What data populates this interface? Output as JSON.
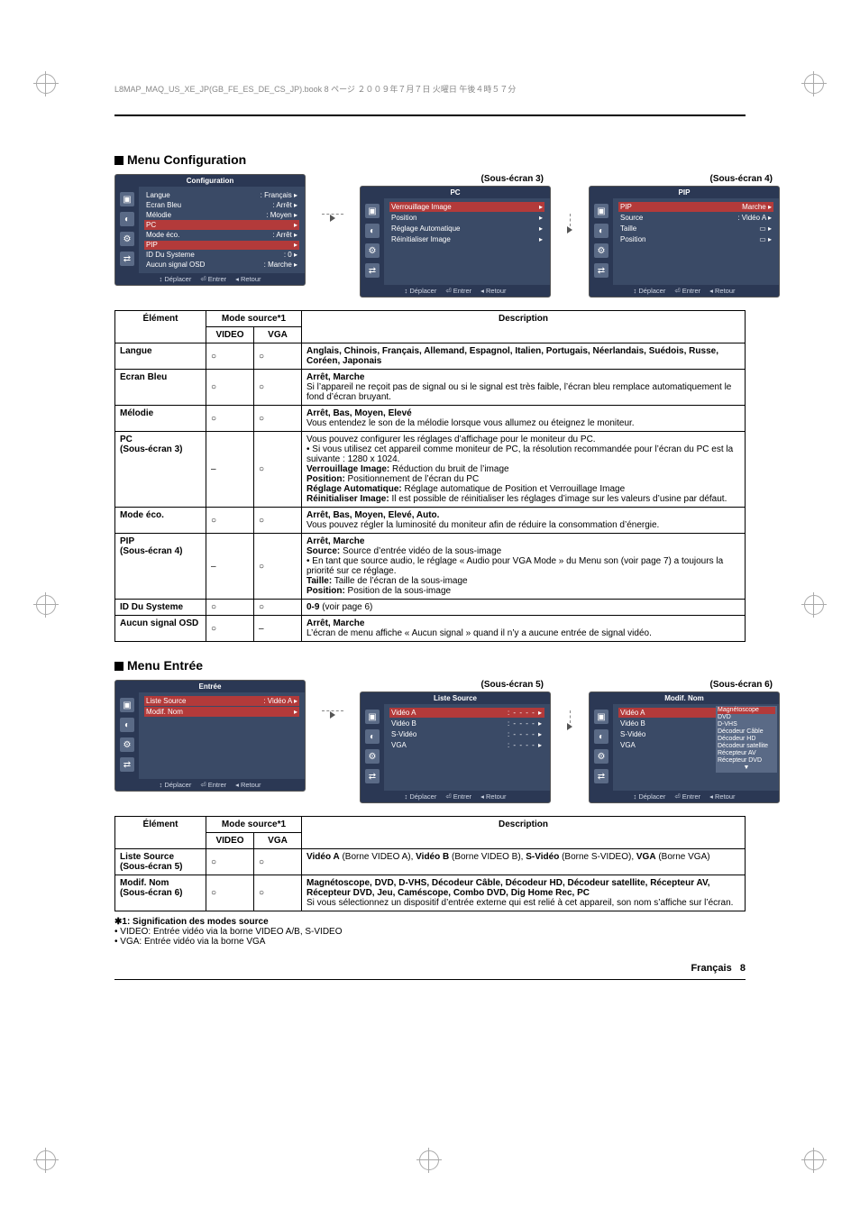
{
  "runhead": "L8MAP_MAQ_US_XE_JP(GB_FE_ES_DE_CS_JP).book  8 ページ  ２００９年７月７日 火曜日 午後４時５７分",
  "section1": {
    "title": "Menu Configuration"
  },
  "section2": {
    "title": "Menu Entrée"
  },
  "sub3": "(Sous-écran 3)",
  "sub4": "(Sous-écran 4)",
  "sub5": "(Sous-écran 5)",
  "sub6": "(Sous-écran 6)",
  "osd": {
    "foot_move": "Déplacer",
    "foot_enter": "Entrer",
    "foot_return": "Retour",
    "config": {
      "title": "Configuration",
      "items": [
        {
          "k": "Langue",
          "v": ": Français"
        },
        {
          "k": "Ecran Bleu",
          "v": ": Arrêt"
        },
        {
          "k": "Mélodie",
          "v": ": Moyen"
        },
        {
          "k": "PC",
          "v": ""
        },
        {
          "k": "Mode éco.",
          "v": ": Arrêt"
        },
        {
          "k": "PIP",
          "v": ""
        },
        {
          "k": "ID Du Systeme",
          "v": ": 0"
        },
        {
          "k": "Aucun signal OSD",
          "v": ": Marche"
        }
      ]
    },
    "pc": {
      "title": "PC",
      "items": [
        {
          "k": "Verrouillage Image",
          "v": ""
        },
        {
          "k": "Position",
          "v": ""
        },
        {
          "k": "Réglage Automatique",
          "v": ""
        },
        {
          "k": "Réinitialiser Image",
          "v": ""
        }
      ]
    },
    "pip": {
      "title": "PIP",
      "items": [
        {
          "k": "PIP",
          "v": "Marche"
        },
        {
          "k": "Source",
          "v": ": Vidéo A"
        },
        {
          "k": "Taille",
          "v": "▭"
        },
        {
          "k": "Position",
          "v": "▭"
        }
      ]
    },
    "entree": {
      "title": "Entrée",
      "items": [
        {
          "k": "Liste Source",
          "v": ": Vidéo A"
        },
        {
          "k": "Modif. Nom",
          "v": ""
        }
      ]
    },
    "liste": {
      "title": "Liste Source",
      "items": [
        {
          "k": "Vidéo A",
          "v": ": - - - -"
        },
        {
          "k": "Vidéo B",
          "v": ": - - - -"
        },
        {
          "k": "S-Vidéo",
          "v": ": - - - -"
        },
        {
          "k": "VGA",
          "v": ": - - - -"
        }
      ]
    },
    "modif": {
      "title": "Modif. Nom",
      "items": [
        {
          "k": "Vidéo A",
          "v": ":"
        },
        {
          "k": "Vidéo B",
          "v": ":"
        },
        {
          "k": "S-Vidéo",
          "v": ":"
        },
        {
          "k": "VGA",
          "v": ":"
        }
      ],
      "options": [
        "Magnétoscope",
        "DVD",
        "D-VHS",
        "Décodeur Câble",
        "Décodeur HD",
        "Décodeur satellite",
        "Récepteur AV",
        "Récepteur DVD"
      ],
      "scroll": "▼"
    }
  },
  "tableHead": {
    "element": "Élément",
    "mode": "Mode source*1",
    "video": "VIDEO",
    "vga": "VGA",
    "desc": "Description"
  },
  "rows1": [
    {
      "el": "Langue",
      "v": "○",
      "g": "○",
      "d": "<b>Anglais, Chinois, Français, Allemand, Espagnol, Italien, Portugais, Néerlandais, Suédois, Russe, Coréen, Japonais</b>"
    },
    {
      "el": "Ecran Bleu",
      "v": "○",
      "g": "○",
      "d": "<b>Arrêt, Marche</b><br>Si l’appareil ne reçoit pas de signal ou si le signal est très faible, l’écran bleu remplace automatiquement le fond d’écran bruyant."
    },
    {
      "el": "Mélodie",
      "v": "○",
      "g": "○",
      "d": "<b>Arrêt, Bas, Moyen, Elevé</b><br>Vous entendez le son de la mélodie lorsque vous allumez ou éteignez le moniteur."
    },
    {
      "el": "PC<br>(Sous-écran 3)",
      "v": "–",
      "g": "○",
      "d": "Vous pouvez configurer les réglages d’affichage pour le moniteur du PC.<br>• Si vous utilisez cet appareil comme moniteur de PC, la résolution recommandée pour l’écran du PC est la suivante : 1280 x 1024.<br><b>Verrouillage Image:</b> Réduction du bruit de l’image<br><b>Position:</b> Positionnement de l’écran du PC<br><b>Réglage Automatique:</b> Réglage automatique de Position et Verrouillage Image<br><b>Réinitialiser Image:</b> Il est possible de réinitialiser les réglages d’image sur les valeurs d’usine par défaut."
    },
    {
      "el": "Mode éco.",
      "v": "○",
      "g": "○",
      "d": "<b>Arrêt, Bas, Moyen, Elevé, Auto.</b><br>Vous pouvez régler la luminosité du moniteur afin de réduire la consommation d’énergie."
    },
    {
      "el": "PIP<br>(Sous-écran 4)",
      "v": "–",
      "g": "○",
      "d": "<b>Arrêt, Marche</b><br><b>Source:</b> Source d’entrée vidéo de la sous-image<br>• En tant que source audio, le réglage « Audio pour VGA Mode » du Menu son (voir page 7) a toujours la priorité sur ce réglage.<br><b>Taille:</b> Taille de l’écran de la sous-image<br><b>Position:</b> Position de la sous-image"
    },
    {
      "el": "ID Du Systeme",
      "v": "○",
      "g": "○",
      "d": "<b>0-9</b> (voir page 6)"
    },
    {
      "el": "Aucun signal OSD",
      "v": "○",
      "g": "–",
      "d": "<b>Arrêt, Marche</b><br>L’écran de menu affiche « Aucun signal » quand il n’y a aucune entrée de signal vidéo."
    }
  ],
  "rows2": [
    {
      "el": "Liste Source<br>(Sous-écran 5)",
      "v": "○",
      "g": "○",
      "d": "<b>Vidéo A</b> (Borne VIDEO A), <b>Vidéo B</b> (Borne VIDEO B), <b>S-Vidéo</b> (Borne S-VIDEO), <b>VGA</b> (Borne VGA)"
    },
    {
      "el": "Modif. Nom<br>(Sous-écran 6)",
      "v": "○",
      "g": "○",
      "d": "<b>Magnétoscope, DVD, D-VHS, Décodeur Câble, Décodeur HD, Décodeur satellite, Récepteur AV, Récepteur DVD, Jeu, Caméscope, Combo DVD, Dig Home Rec, PC</b><br>Si vous sélectionnez un dispositif d’entrée externe qui est relié à cet appareil, son nom s’affiche sur l’écran."
    }
  ],
  "footnotes": {
    "t": "✱1: Signification des modes source",
    "a": "• VIDEO: Entrée vidéo via la borne VIDEO A/B, S-VIDEO",
    "b": "• VGA: Entrée vidéo via la borne VGA"
  },
  "pagefoot": {
    "lang": "Français",
    "num": "8"
  }
}
